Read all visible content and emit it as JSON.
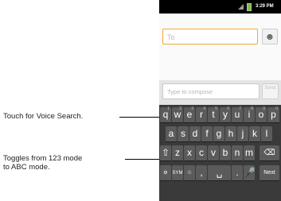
{
  "status_bar": {
    "time": "3:29 PM"
  },
  "to_field": {
    "placeholder": "To"
  },
  "compose": {
    "placeholder": "Type to compose",
    "send_label": "Send"
  },
  "keyboard": {
    "row1": [
      {
        "key": "q",
        "num": "1"
      },
      {
        "key": "w",
        "num": "2"
      },
      {
        "key": "e",
        "num": "3"
      },
      {
        "key": "r",
        "num": "4"
      },
      {
        "key": "t",
        "num": "5"
      },
      {
        "key": "y",
        "num": "6"
      },
      {
        "key": "u",
        "num": "7"
      },
      {
        "key": "i",
        "num": "8"
      },
      {
        "key": "o",
        "num": "9"
      },
      {
        "key": "p",
        "num": "0"
      }
    ],
    "row2": [
      "a",
      "s",
      "d",
      "f",
      "g",
      "h",
      "j",
      "k",
      "l"
    ],
    "row3": [
      "z",
      "x",
      "c",
      "v",
      "b",
      "n",
      "m"
    ],
    "sym_label": "SYM",
    "next_label": "Next",
    "period": "."
  },
  "callouts": {
    "voice_search": "Touch for Voice Search.",
    "toggle_line1": "Toggles from 123 mode",
    "toggle_line2": "to ABC mode."
  }
}
